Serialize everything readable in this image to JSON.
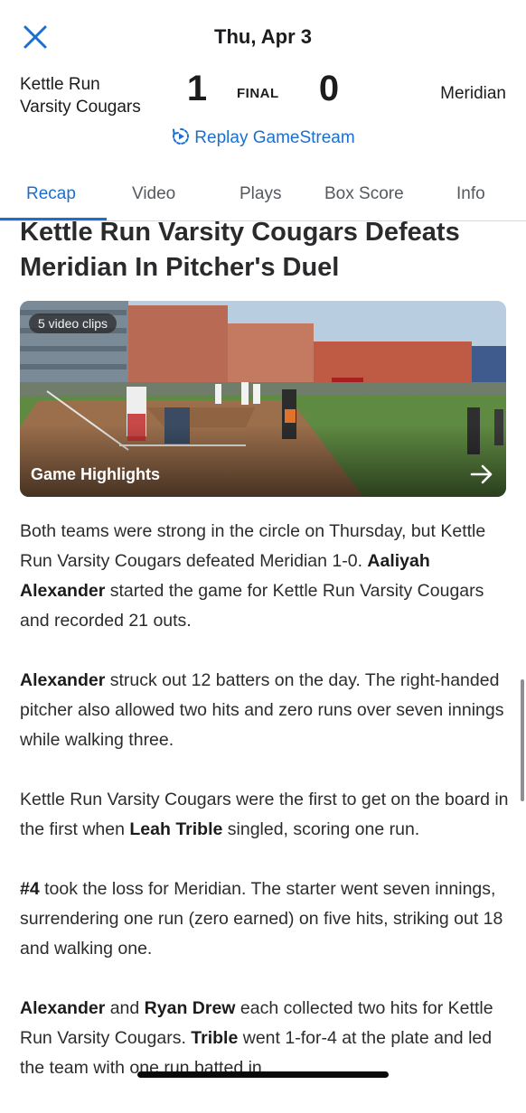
{
  "header": {
    "date": "Thu, Apr 3",
    "close_icon": "close-icon"
  },
  "score": {
    "home_team_line1": "Kettle Run",
    "home_team_line2": "Varsity Cougars",
    "home_score": "1",
    "status": "FINAL",
    "away_score": "0",
    "away_team": "Meridian",
    "replay_label": "Replay GameStream"
  },
  "tabs": [
    {
      "label": "Recap",
      "active": true
    },
    {
      "label": "Video",
      "active": false
    },
    {
      "label": "Plays",
      "active": false
    },
    {
      "label": "Box Score",
      "active": false
    },
    {
      "label": "Info",
      "active": false
    }
  ],
  "headline": "Kettle Run Varsity Cougars Defeats Meridian In Pitcher's Duel",
  "video": {
    "badge": "5 video clips",
    "title": "Game Highlights"
  },
  "article": {
    "p1": {
      "a": "Both teams were strong in the circle on Thursday, but Kettle Run Varsity Cougars defeated Meridian 1-0. ",
      "b": "Aaliyah Alexander",
      "c": " started the game for Kettle Run Varsity Cougars and recorded 21 outs."
    },
    "p2": {
      "b": "Alexander",
      "c": " struck out 12 batters on the day. The right-handed pitcher also allowed two hits and zero runs over seven innings while walking three."
    },
    "p3": {
      "a": "Kettle Run Varsity Cougars were the first to get on the board in the first when ",
      "b": "Leah Trible",
      "c": " singled, scoring one run."
    },
    "p4": {
      "b": "#4",
      "c": " took the loss for Meridian. The starter went seven innings, surrendering one run (zero earned) on five hits, striking out 18 and walking one."
    },
    "p5": {
      "b1": "Alexander",
      "a": " and ",
      "b2": "Ryan Drew",
      "c": " each collected two hits for Kettle Run Varsity Cougars. ",
      "b3": "Trible",
      "d": " went 1-for-4 at the plate and led the team with one run batted in."
    }
  },
  "colors": {
    "accent": "#1a6fd1",
    "text": "#1c1c1e"
  }
}
